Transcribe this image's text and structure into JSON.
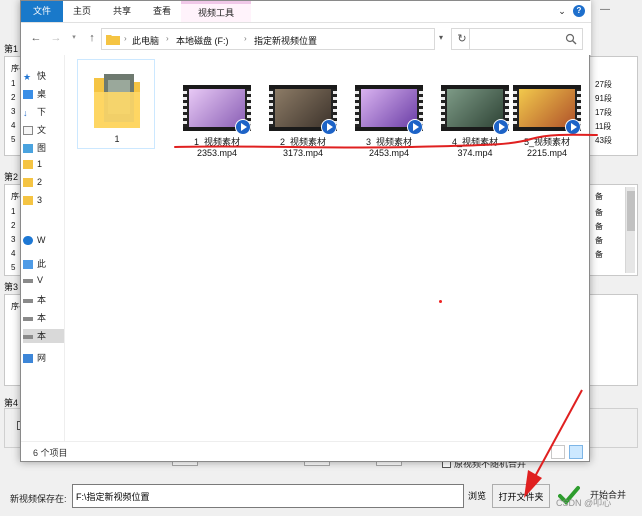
{
  "window": {
    "ribbon_tabs": [
      "文件",
      "主页",
      "共享",
      "查看",
      "视频工具"
    ],
    "help": "?",
    "chevron": "⌄"
  },
  "address": {
    "crumbs": [
      "此电脑",
      "本地磁盘 (F:)",
      "指定新视频位置"
    ],
    "separator": "›"
  },
  "nav": {
    "items": [
      {
        "label": "快",
        "icon": "star-icon"
      },
      {
        "label": "桌",
        "icon": "desktop-icon"
      },
      {
        "label": "下",
        "icon": "download-icon"
      },
      {
        "label": "文",
        "icon": "document-icon"
      },
      {
        "label": "图",
        "icon": "picture-icon"
      },
      {
        "label": "1",
        "icon": "folder-icon"
      },
      {
        "label": "2",
        "icon": "folder-icon"
      },
      {
        "label": "3",
        "icon": "folder-icon"
      },
      {
        "label": "W",
        "icon": "cloud-icon"
      },
      {
        "label": "此",
        "icon": "pc-icon"
      },
      {
        "label": "V",
        "icon": "drive-icon"
      },
      {
        "label": "本",
        "icon": "drive-icon"
      },
      {
        "label": "本",
        "icon": "drive-icon"
      },
      {
        "label": "本",
        "icon": "drive-icon"
      },
      {
        "label": "网",
        "icon": "network-icon"
      }
    ]
  },
  "files": {
    "folder": {
      "name": "1"
    },
    "videos": [
      {
        "line1": "1_视频素材",
        "line2": "2353.mp4",
        "scene": "#c79bd8"
      },
      {
        "line1": "2_视频素材",
        "line2": "3173.mp4",
        "scene": "#6b5a4a"
      },
      {
        "line1": "3_视频素材",
        "line2": "2453.mp4",
        "scene": "#b48fd6"
      },
      {
        "line1": "4_视频素材",
        "line2": "374.mp4",
        "scene": "#4d6b5a"
      },
      {
        "line1": "5_视频素材",
        "line2": "2215.mp4",
        "scene": "#d8a338"
      }
    ]
  },
  "status": {
    "count": "6 个项目"
  },
  "background_app": {
    "groups": [
      {
        "title": "第1",
        "col": "序-",
        "rows": [
          "1",
          "2",
          "3",
          "4",
          "5"
        ],
        "right": [
          "27段",
          "91段",
          "17段",
          "11段",
          "43段"
        ]
      },
      {
        "title": "第2",
        "col": "序-",
        "rows": [
          "1",
          "2",
          "3",
          "4",
          "5"
        ],
        "right": [
          "备",
          "备",
          "备",
          "备",
          "备"
        ]
      },
      {
        "title": "第3",
        "col": "序-",
        "rows": [],
        "right": []
      }
    ],
    "group4_title": "第4",
    "save_label": "新视频保存在:",
    "save_path": "F:\\指定新视频位置",
    "browse": "浏览",
    "open_folder": "打开文件夹",
    "merge": "开始合并",
    "nonrandom": "原视频不随机合并",
    "watermark": "CSDN @叩心"
  },
  "colors": {
    "accent": "#1979ca",
    "annotation_red": "#e02020"
  }
}
